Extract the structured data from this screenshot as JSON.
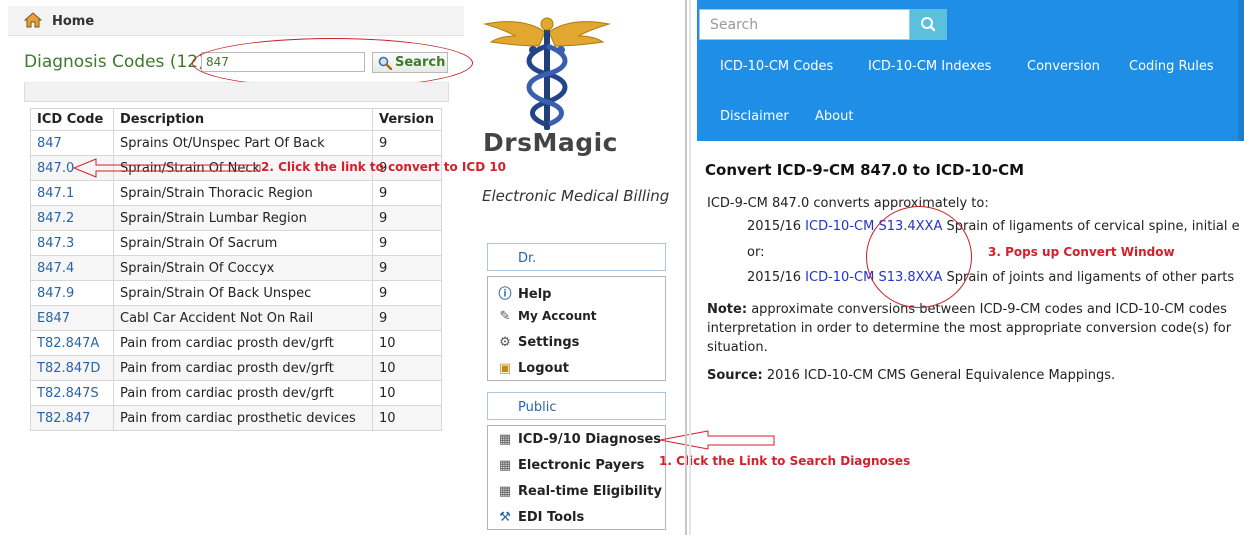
{
  "left": {
    "home_label": "Home",
    "diagnosis_title": "Diagnosis Codes (12)",
    "search_value": "847",
    "search_button": "Search",
    "columns": [
      "ICD Code",
      "Description",
      "Version"
    ],
    "rows": [
      [
        "847",
        "Sprains Ot/Unspec Part Of Back",
        "9"
      ],
      [
        "847.0",
        "Sprain/Strain Of Neck",
        "9"
      ],
      [
        "847.1",
        "Sprain/Strain Thoracic Region",
        "9"
      ],
      [
        "847.2",
        "Sprain/Strain Lumbar Region",
        "9"
      ],
      [
        "847.3",
        "Sprain/Strain Of Sacrum",
        "9"
      ],
      [
        "847.4",
        "Sprain/Strain Of Coccyx",
        "9"
      ],
      [
        "847.9",
        "Sprain/Strain Of Back Unspec",
        "9"
      ],
      [
        "E847",
        "Cabl Car Accident Not On Rail",
        "9"
      ],
      [
        "T82.847A",
        "Pain from cardiac prosth dev/grft",
        "10"
      ],
      [
        "T82.847D",
        "Pain from cardiac prosth dev/grft",
        "10"
      ],
      [
        "T82.847S",
        "Pain from cardiac prosth dev/grft",
        "10"
      ],
      [
        "T82.847",
        "Pain from cardiac prosthetic devices",
        "10"
      ]
    ],
    "annotation_2": "2. Click the link to convert to ICD 10"
  },
  "middle": {
    "brand": "DrsMagic",
    "brand_sub": "Electronic Medical Billing",
    "dr_box": "Dr.",
    "account_menu": [
      "Help",
      "My Account",
      "Settings",
      "Logout"
    ],
    "public_box": "Public",
    "public_menu": [
      "ICD-9/10 Diagnoses",
      "Electronic Payers",
      "Real-time Eligibility",
      "EDI Tools"
    ],
    "annotation_1": "1. Click the Link to Search Diagnoses"
  },
  "right": {
    "search_placeholder": "Search",
    "nav_row1": [
      "ICD-10-CM Codes",
      "ICD-10-CM Indexes",
      "Conversion",
      "Coding Rules"
    ],
    "nav_row2": [
      "Disclaimer",
      "About"
    ],
    "title": "Convert ICD-9-CM 847.0 to ICD-10-CM",
    "intro": "ICD-9-CM 847.0 converts approximately to:",
    "b1_year": "2015/16",
    "b1_sys": "ICD-10-CM",
    "b1_code": "S13.4XXA",
    "b1_desc": "Sprain of ligaments of cervical spine, initial e",
    "or": "or:",
    "b2_year": "2015/16",
    "b2_sys": "ICD-10-CM",
    "b2_code": "S13.8XXA",
    "b2_desc": "Sprain of joints and ligaments of other parts",
    "note_label": "Note:",
    "note_l1": "approximate conversions between ICD-9-CM codes and ICD-10-CM codes",
    "note_l2": "interpretation in order to determine the most appropriate conversion code(s) for",
    "note_l3": "situation.",
    "source_label": "Source:",
    "source_text": "2016 ICD-10-CM CMS General Equivalence Mappings.",
    "annotation_3": "3. Pops up Convert Window"
  },
  "colors": {
    "nav_blue": "#1f8ee6",
    "search_btn": "#5bc0de",
    "green_title": "#3c7a2a",
    "link_blue": "#2a64a8",
    "annotation_red": "#d4202a"
  }
}
